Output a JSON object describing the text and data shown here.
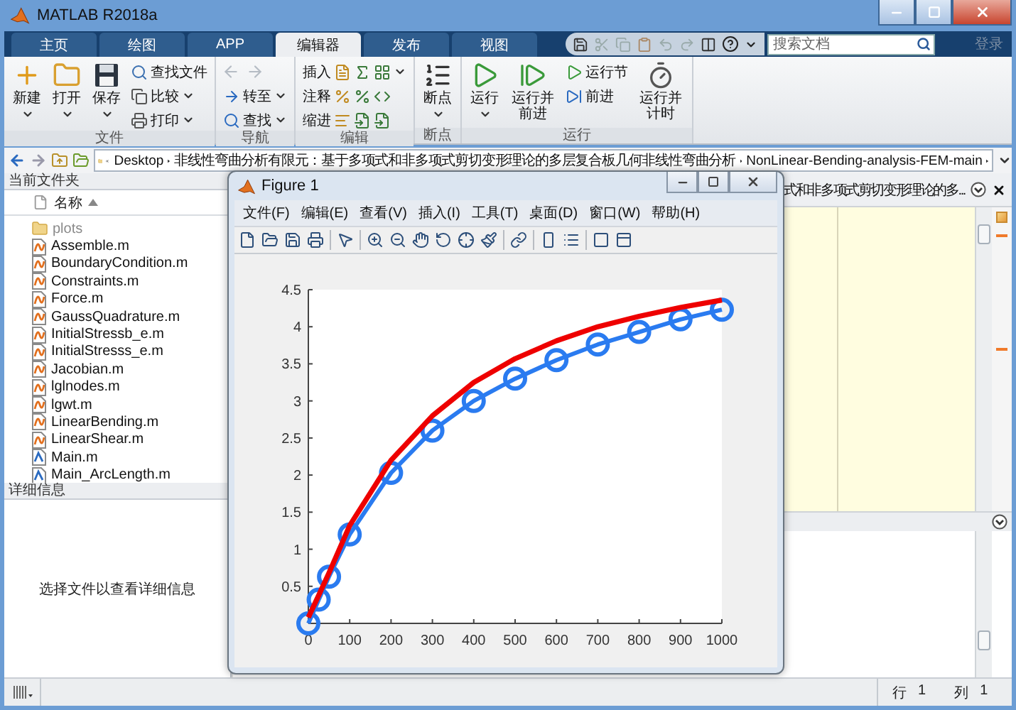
{
  "window": {
    "title": "MATLAB R2018a"
  },
  "tabs": [
    {
      "label": "主页",
      "selected": false
    },
    {
      "label": "绘图",
      "selected": false
    },
    {
      "label": "APP",
      "selected": false
    },
    {
      "label": "编辑器",
      "selected": true
    },
    {
      "label": "发布",
      "selected": false
    },
    {
      "label": "视图",
      "selected": false
    }
  ],
  "search": {
    "placeholder": "搜索文档"
  },
  "sign_in": "登录",
  "ribbon": {
    "groups": [
      {
        "title": "文件",
        "items": [
          {
            "kind": "large",
            "label": "新建",
            "dropdown": true
          },
          {
            "kind": "large",
            "label": "打开",
            "dropdown": true
          },
          {
            "kind": "large",
            "label": "保存",
            "dropdown": true
          },
          {
            "kind": "small",
            "label": "查找文件",
            "dropdown": false
          },
          {
            "kind": "small",
            "label": "比较",
            "dropdown": true
          },
          {
            "kind": "small",
            "label": "打印",
            "dropdown": true
          }
        ]
      },
      {
        "title": "导航",
        "items": [
          {
            "kind": "history",
            "disabled": true
          },
          {
            "kind": "small",
            "label": "转至",
            "dropdown": true
          },
          {
            "kind": "small",
            "label": "查找",
            "dropdown": true
          }
        ]
      },
      {
        "title": "编辑",
        "items": [
          {
            "kind": "tools",
            "label": "插入",
            "dropdown": true
          },
          {
            "kind": "tools",
            "label": "注释",
            "dropdown": false
          },
          {
            "kind": "tools",
            "label": "缩进",
            "dropdown": false
          }
        ]
      },
      {
        "title": "断点",
        "items": [
          {
            "kind": "large",
            "label": "断点",
            "dropdown": true
          }
        ]
      },
      {
        "title": "运行",
        "items": [
          {
            "kind": "large",
            "label": "运行",
            "dropdown": true
          },
          {
            "kind": "large",
            "label": "运行并前进",
            "dropdown": false
          },
          {
            "kind": "small",
            "label": "运行节",
            "dropdown": false
          },
          {
            "kind": "small",
            "label": "前进",
            "dropdown": false
          },
          {
            "kind": "large",
            "label": "运行并计时",
            "dropdown": false
          }
        ]
      }
    ]
  },
  "address_bar": {
    "segments": [
      "Desktop",
      "非线性弯曲分析有限元：基于多项式和非多项式剪切变形理论的多层复合板几何非线性弯曲分析",
      "NonLinear-Bending-analysis-FEM-main"
    ]
  },
  "current_folder": {
    "title": "当前文件夹",
    "column": "名称",
    "files": [
      {
        "name": "plots",
        "kind": "folder"
      },
      {
        "name": "Assemble.m",
        "kind": "function"
      },
      {
        "name": "BoundaryCondition.m",
        "kind": "function"
      },
      {
        "name": "Constraints.m",
        "kind": "function"
      },
      {
        "name": "Force.m",
        "kind": "function"
      },
      {
        "name": "GaussQuadrature.m",
        "kind": "function"
      },
      {
        "name": "InitialStressb_e.m",
        "kind": "function"
      },
      {
        "name": "InitialStresss_e.m",
        "kind": "function"
      },
      {
        "name": "Jacobian.m",
        "kind": "function"
      },
      {
        "name": "lglnodes.m",
        "kind": "function"
      },
      {
        "name": "lgwt.m",
        "kind": "function"
      },
      {
        "name": "LinearBending.m",
        "kind": "function"
      },
      {
        "name": "LinearShear.m",
        "kind": "function"
      },
      {
        "name": "Main.m",
        "kind": "script"
      },
      {
        "name": "Main_ArcLength.m",
        "kind": "script"
      }
    ]
  },
  "details": {
    "title": "详细信息",
    "message": "选择文件以查看详细信息"
  },
  "editor": {
    "tab_title": "式和非多项式剪切变形理论的多..."
  },
  "status_bar": [
    {
      "label": "行",
      "value": "1"
    },
    {
      "label": "列",
      "value": "1"
    }
  ],
  "figure": {
    "title": "Figure 1",
    "menus": [
      "文件(F)",
      "编辑(E)",
      "查看(V)",
      "插入(I)",
      "工具(T)",
      "桌面(D)",
      "窗口(W)",
      "帮助(H)"
    ],
    "chart_data": {
      "type": "line",
      "xlim": [
        0,
        1000
      ],
      "ylim": [
        0,
        4.5
      ],
      "xticks": [
        0,
        100,
        200,
        300,
        400,
        500,
        600,
        700,
        800,
        900,
        1000
      ],
      "yticks": [
        0.5,
        1,
        1.5,
        2,
        2.5,
        3,
        3.5,
        4,
        4.5
      ],
      "x": [
        0,
        25,
        50,
        100,
        200,
        300,
        400,
        500,
        600,
        700,
        800,
        900,
        1000
      ],
      "series": [
        {
          "color": "#2a7bf0",
          "marker": "o",
          "values": [
            0,
            0.32,
            0.63,
            1.2,
            2.03,
            2.6,
            3.0,
            3.3,
            3.55,
            3.76,
            3.93,
            4.1,
            4.23
          ]
        },
        {
          "color": "#ee0000",
          "values": [
            0.08,
            0.38,
            0.68,
            1.32,
            2.2,
            2.8,
            3.25,
            3.57,
            3.81,
            4.0,
            4.14,
            4.26,
            4.36
          ]
        }
      ]
    }
  }
}
